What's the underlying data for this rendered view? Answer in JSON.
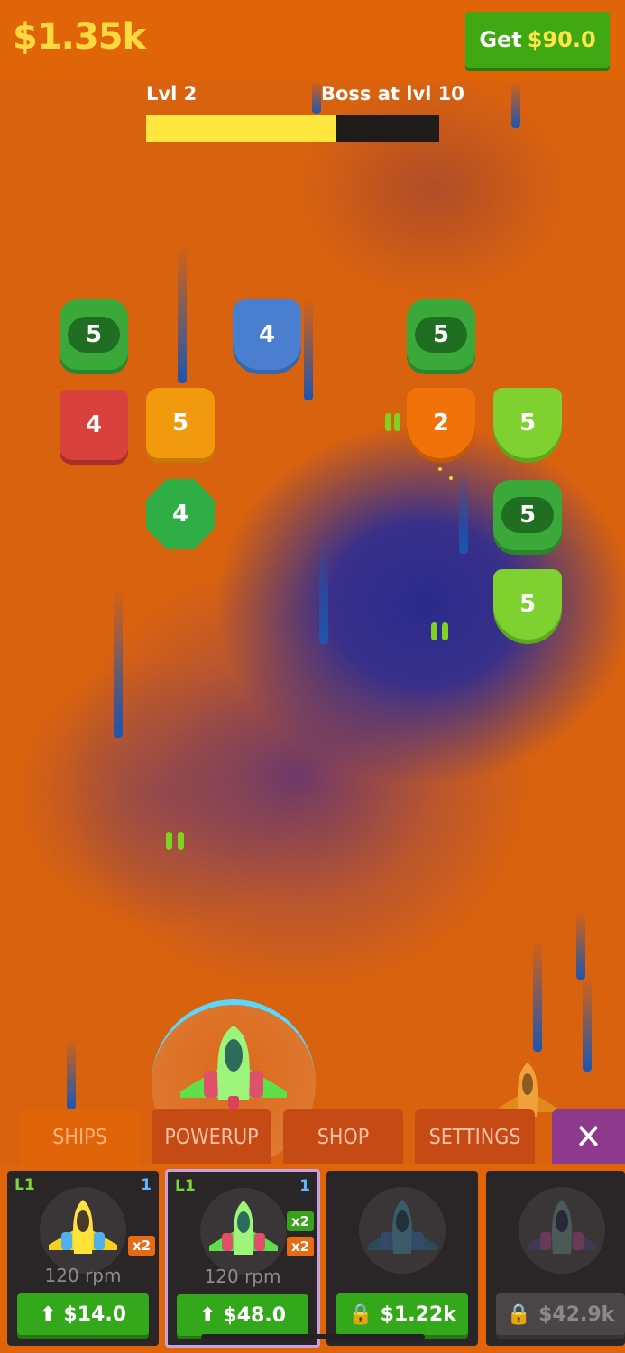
{
  "hud": {
    "money": "$1.35k",
    "get_prefix": "Get",
    "get_amount": "$90.0",
    "level": "Lvl 2",
    "boss": "Boss at lvl 10",
    "level_progress_percent": 65
  },
  "blocks": [
    {
      "value": "5",
      "style": "green-oval"
    },
    {
      "value": "4",
      "style": "blue"
    },
    {
      "value": "5",
      "style": "green-oval"
    },
    {
      "value": "4",
      "style": "red"
    },
    {
      "value": "5",
      "style": "orange"
    },
    {
      "value": "2",
      "style": "orange-shield"
    },
    {
      "value": "5",
      "style": "lime-shield"
    },
    {
      "value": "4",
      "style": "green-octagon"
    },
    {
      "value": "5",
      "style": "green-cat"
    },
    {
      "value": "5",
      "style": "lime-shield"
    }
  ],
  "tabs": {
    "ships": "SHIPS",
    "powerup": "POWERUP",
    "shop": "SHOP",
    "settings": "SETTINGS",
    "close": "✕"
  },
  "ships": [
    {
      "level": "L1",
      "count": "1",
      "rpm": "120 rpm",
      "price": "$14.0",
      "action_icon": "arrow-up-icon",
      "badges": [
        "x2"
      ],
      "color": "#f5d21a"
    },
    {
      "level": "L1",
      "count": "1",
      "rpm": "120 rpm",
      "price": "$48.0",
      "action_icon": "arrow-up-icon",
      "badges": [
        "x2",
        "x2"
      ],
      "color": "#7de85a"
    },
    {
      "price": "$1.22k",
      "action_icon": "lock-icon",
      "color": "#3b5a6a"
    },
    {
      "price": "$42.9k",
      "action_icon": "lock-icon",
      "color": "#5a4a6a"
    }
  ],
  "colors": {
    "background": "#d9620f",
    "money": "#ffd93d",
    "progress_fill": "#ffe740",
    "button_green": "#33a81a"
  }
}
